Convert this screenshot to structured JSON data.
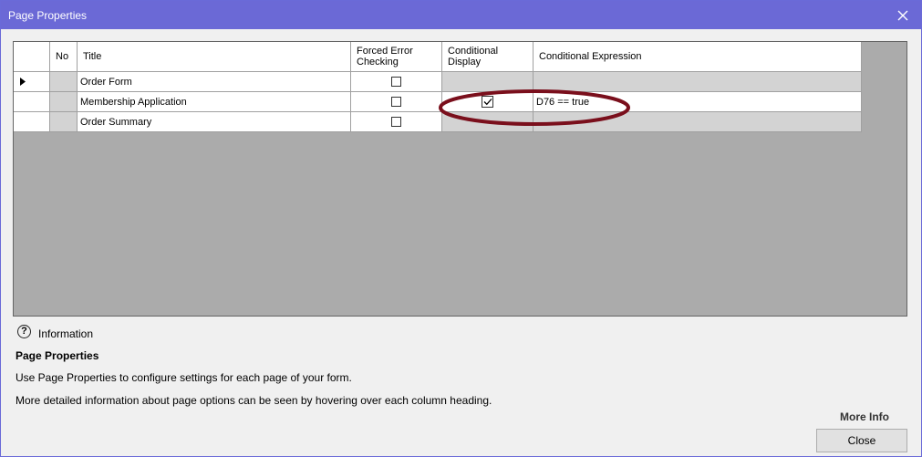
{
  "window": {
    "title": "Page Properties"
  },
  "grid": {
    "columns": [
      "",
      "No",
      "Title",
      "Forced Error Checking",
      "Conditional Display",
      "Conditional Expression"
    ],
    "rows": [
      {
        "title": "Order Form",
        "forced_error": false,
        "conditional_display": false,
        "expression": ""
      },
      {
        "title": "Membership Application",
        "forced_error": false,
        "conditional_display": true,
        "expression": "D76 == true"
      },
      {
        "title": "Order Summary",
        "forced_error": false,
        "conditional_display": false,
        "expression": ""
      }
    ]
  },
  "info": {
    "label": "Information",
    "heading": "Page Properties",
    "line1": "Use Page Properties to configure settings for each page of your form.",
    "line2": "More detailed information about page options can be seen by hovering over each column heading."
  },
  "buttons": {
    "more_info": "More Info",
    "close": "Close"
  },
  "colors": {
    "titlebar": "#6b69d6",
    "annotation": "#7a0f1c"
  }
}
